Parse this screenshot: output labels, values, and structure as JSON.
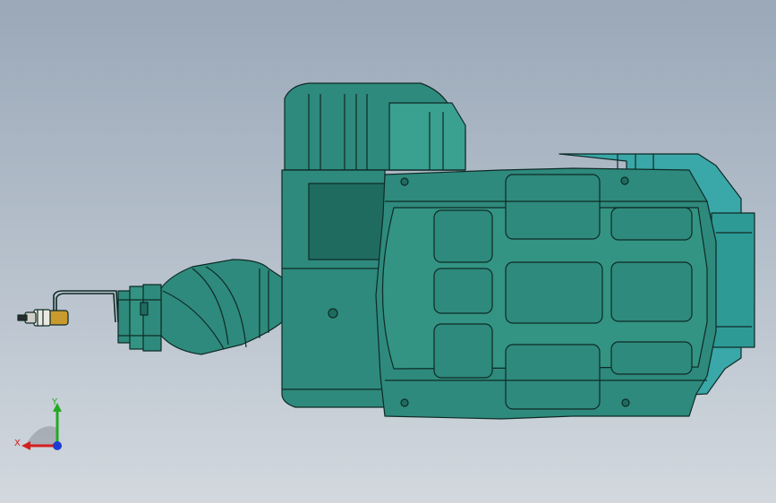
{
  "viewport": {
    "background_top": "#9aa8b8",
    "background_bottom": "#d2d8de"
  },
  "model": {
    "body_color": "#2e8a7c",
    "body_dark": "#1f6b60",
    "body_light": "#3aa090",
    "edge_color": "#0e2a26",
    "motor_cap_color": "#3aa7a8",
    "tool_gold": "#c99a2e"
  },
  "triad": {
    "x_label": "X",
    "y_label": "Y",
    "x_color": "#d42020",
    "y_color": "#22aa22",
    "z_color": "#1e3cd4"
  }
}
